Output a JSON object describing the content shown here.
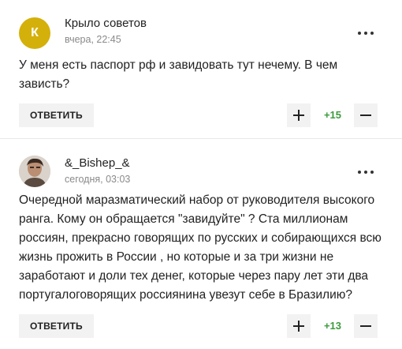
{
  "comments": [
    {
      "author": "Крыло советов",
      "avatar_letter": "К",
      "time": "вчера, 22:45",
      "text": "У меня есть паспорт рф и завидовать тут нечему. В чем зависть?",
      "reply_label": "ОТВЕТИТЬ",
      "score": "+15"
    },
    {
      "author": "&_Bishep_&",
      "time": "сегодня, 03:03",
      "text": "Очередной маразматический набор от руководителя высокого ранга. Кому он обращается \"завидуйте\" ? Ста миллионам россиян, прекрасно говорящих по русских и собирающихся всю жизнь прожить в России , но которые и за три жизни не заработают и доли тех денег, которые через пару лет эти два португалоговорящих россиянина увезут себе в Бразилию?",
      "reply_label": "ОТВЕТИТЬ",
      "score": "+13"
    }
  ],
  "colors": {
    "avatar_yellow": "#d4b00a",
    "score_green": "#3d9b3d",
    "button_bg": "#f2f2f2"
  },
  "icons": [
    "more-icon",
    "plus-icon",
    "minus-icon"
  ]
}
